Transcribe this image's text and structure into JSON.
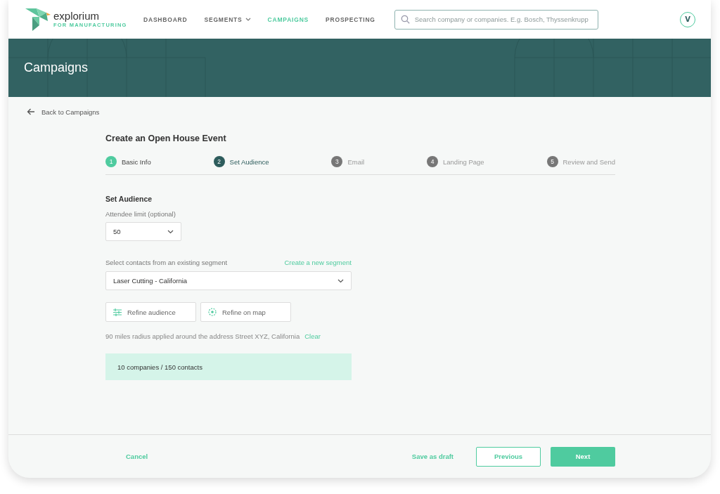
{
  "logo": {
    "name": "explorium",
    "tagline": "FOR MANUFACTURING"
  },
  "nav": [
    {
      "label": "DASHBOARD",
      "selected": false,
      "dropdown": false
    },
    {
      "label": "SEGMENTS",
      "selected": false,
      "dropdown": true
    },
    {
      "label": "CAMPAIGNS",
      "selected": true,
      "dropdown": false
    },
    {
      "label": "PROSPECTING",
      "selected": false,
      "dropdown": false
    }
  ],
  "search": {
    "placeholder": "Search company or companies. E.g. Bosch, Thyssenkrupp"
  },
  "avatar": "V",
  "banner": {
    "title": "Campaigns"
  },
  "back_link": "Back to Campaigns",
  "form_title": "Create an Open House Event",
  "steps": [
    {
      "number": "1",
      "label": "Basic Info",
      "completed": true,
      "selected": false
    },
    {
      "number": "2",
      "label": "Set Audience",
      "completed": false,
      "selected": true
    },
    {
      "number": "3",
      "label": "Email",
      "completed": false,
      "selected": false
    },
    {
      "number": "4",
      "label": "Landing Page",
      "completed": false,
      "selected": false
    },
    {
      "number": "5",
      "label": "Review and Send",
      "completed": false,
      "selected": false
    }
  ],
  "section_title": "Set Audience",
  "attendee_limit": {
    "label": "Attendee limit (optional)",
    "value": "50"
  },
  "segment": {
    "label": "Select contacts from an existing segment",
    "link": "Create a new segment",
    "value": "Laser Cutting - California"
  },
  "refine_buttons": [
    {
      "label": "Refine audience",
      "kind": "sliders"
    },
    {
      "label": "Refine on map",
      "kind": "target"
    }
  ],
  "radius_note": {
    "text": "90 miles radius applied around the address Street XYZ, California",
    "link": "Clear"
  },
  "summary": "10 companies / 150 contacts",
  "footer": {
    "cancel": "Cancel",
    "save": "Save as draft",
    "previous": "Previous",
    "next": "Next"
  }
}
